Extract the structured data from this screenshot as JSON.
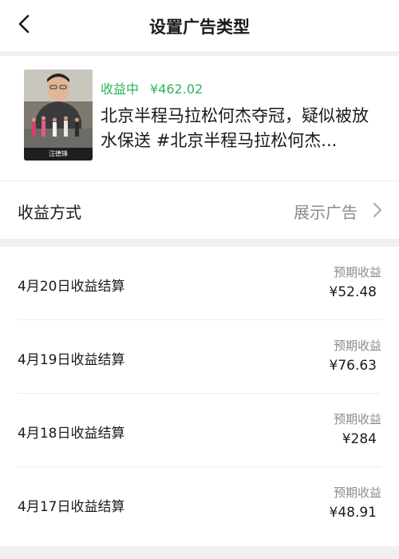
{
  "header": {
    "title": "设置广告类型",
    "back_icon": "chevron-left-icon"
  },
  "video": {
    "status_label": "收益中",
    "earnings": "¥462.02",
    "title": "北京半程马拉松何杰夺冠，疑似被放水保送 #北京半程马拉松何杰...",
    "thumbnail_caption": "汪德锋",
    "status_color": "#2db45a"
  },
  "earning_method": {
    "label": "收益方式",
    "value": "展示广告",
    "chevron_icon": "chevron-right-icon"
  },
  "settlements": [
    {
      "label": "4月20日收益结算",
      "caption": "预期收益",
      "amount": "¥52.48"
    },
    {
      "label": "4月19日收益结算",
      "caption": "预期收益",
      "amount": "¥76.63"
    },
    {
      "label": "4月18日收益结算",
      "caption": "预期收益",
      "amount": "¥284"
    },
    {
      "label": "4月17日收益结算",
      "caption": "预期收益",
      "amount": "¥48.91"
    }
  ]
}
